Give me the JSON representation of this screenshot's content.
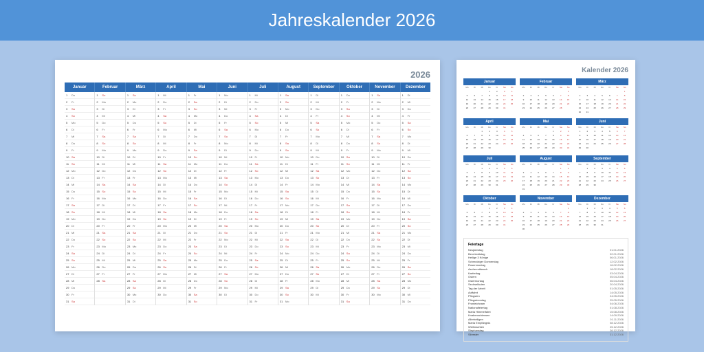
{
  "header": "Jahreskalender 2026",
  "year": "2026",
  "sheet2_title": "Kalender 2026",
  "months": [
    "Januar",
    "Februar",
    "März",
    "April",
    "Mai",
    "Juni",
    "Juli",
    "August",
    "September",
    "Oktober",
    "November",
    "Dezember"
  ],
  "weekdays_short": [
    "Mo",
    "Di",
    "Mi",
    "Do",
    "Fr",
    "Sa",
    "So"
  ],
  "holidays_title": "Feiertage",
  "holidays": [
    {
      "name": "Neujahrstag",
      "date": "01.01.2026"
    },
    {
      "name": "Berchtoldstag",
      "date": "02.01.2026"
    },
    {
      "name": "Heilige 3 Könige",
      "date": "06.01.2026"
    },
    {
      "name": "Schmutziger Donnerstag",
      "date": "12.02.2026"
    },
    {
      "name": "Rosenmontag",
      "date": "16.02.2026"
    },
    {
      "name": "Aschermittwoch",
      "date": "18.02.2026"
    },
    {
      "name": "Karfreitag",
      "date": "03.04.2026"
    },
    {
      "name": "Ostern",
      "date": "05.04.2026"
    },
    {
      "name": "Ostermontag",
      "date": "06.04.2026"
    },
    {
      "name": "Sechseläuten",
      "date": "20.04.2026"
    },
    {
      "name": "Tag der Arbeit",
      "date": "01.05.2026"
    },
    {
      "name": "Auffahrt",
      "date": "14.05.2026"
    },
    {
      "name": "Pfingsten",
      "date": "24.05.2026"
    },
    {
      "name": "Pfingstmontag",
      "date": "25.05.2026"
    },
    {
      "name": "Fronleichnam",
      "date": "04.06.2026"
    },
    {
      "name": "Nationalfeiertag",
      "date": "01.08.2026"
    },
    {
      "name": "Maria Himmelfahrt",
      "date": "15.08.2026"
    },
    {
      "name": "Knabenschiessen",
      "date": "14.09.2026"
    },
    {
      "name": "Allerheiligen",
      "date": "01.11.2026"
    },
    {
      "name": "Maria Empfängnis",
      "date": "08.12.2026"
    },
    {
      "name": "Weihnachten",
      "date": "25.12.2026"
    },
    {
      "name": "Stephanstag",
      "date": "26.12.2026"
    },
    {
      "name": "Silvester",
      "date": "31.12.2026"
    }
  ],
  "month_starts": [
    4,
    7,
    7,
    3,
    5,
    1,
    3,
    6,
    2,
    4,
    7,
    2
  ],
  "month_lengths": [
    31,
    28,
    31,
    30,
    31,
    30,
    31,
    31,
    30,
    31,
    30,
    31
  ]
}
